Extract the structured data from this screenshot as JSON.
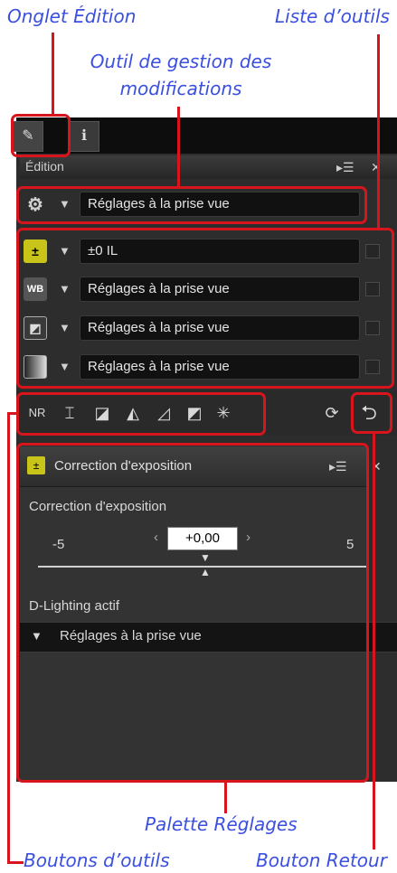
{
  "callouts": {
    "edit_tab": "Onglet Édition",
    "tool_list": "Liste d’outils",
    "adjust_manager_line1": "Outil de gestion des",
    "adjust_manager_line2": "modifications",
    "adjust_palette": "Palette Réglages",
    "tool_buttons": "Boutons d’outils",
    "back_button": "Bouton Retour"
  },
  "panel": {
    "title": "Édition",
    "manager_value": "Réglages à la prise vue",
    "tools": [
      {
        "icon": "exposure-icon",
        "value": "±0 IL"
      },
      {
        "icon": "white-balance-icon",
        "value": "Réglages à la prise vue"
      },
      {
        "icon": "picture-control-icon",
        "value": "Réglages à la prise vue"
      },
      {
        "icon": "levels-curves-icon",
        "value": "Réglages à la prise vue"
      }
    ],
    "wb_label": "WB"
  },
  "palette": {
    "title": "Correction d'exposition",
    "section_label": "Correction d'exposition",
    "min": "-5",
    "max": "5",
    "value": "+0,00",
    "dlighting_label": "D-Lighting actif",
    "dlighting_value": "Réglages à la prise vue"
  },
  "colors": {
    "callout": "#3b4fe0",
    "highlight": "#d8141c"
  }
}
